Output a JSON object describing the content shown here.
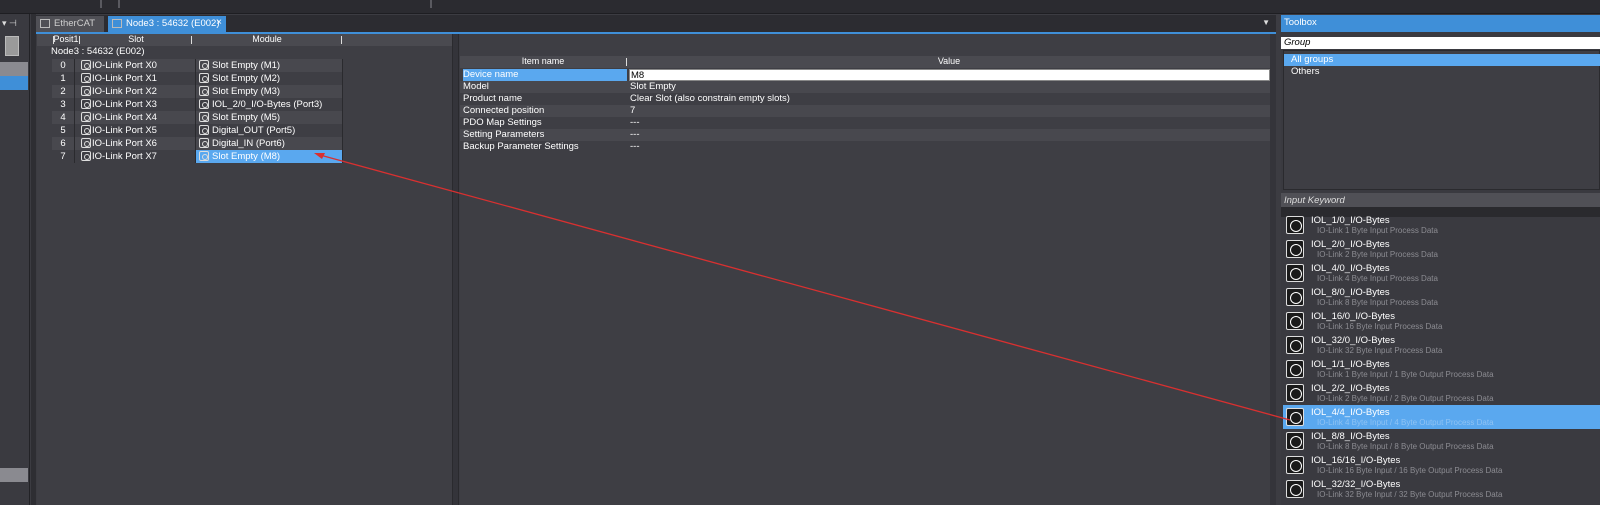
{
  "tabs": [
    {
      "label": "EtherCAT",
      "active": false
    },
    {
      "label": "Node3 : 54632 (E002)",
      "active": true,
      "close": "×"
    }
  ],
  "tab_menu_glyph": "▼",
  "left_dock_pin": "▾ ⊣",
  "module_table": {
    "headers": {
      "position": "Posit1",
      "slot": "Slot",
      "module": "Module"
    },
    "node_label": "Node3 : 54632 (E002)",
    "rows": [
      {
        "pos": "0",
        "slot": "IO-Link Port X0",
        "module": "Slot Empty (M1)",
        "selected": false
      },
      {
        "pos": "1",
        "slot": "IO-Link Port X1",
        "module": "Slot Empty (M2)",
        "selected": false
      },
      {
        "pos": "2",
        "slot": "IO-Link Port X2",
        "module": "Slot Empty (M3)",
        "selected": false
      },
      {
        "pos": "3",
        "slot": "IO-Link Port X3",
        "module": "IOL_2/0_I/O-Bytes (Port3)",
        "selected": false
      },
      {
        "pos": "4",
        "slot": "IO-Link Port X4",
        "module": "Slot Empty (M5)",
        "selected": false
      },
      {
        "pos": "5",
        "slot": "IO-Link Port X5",
        "module": "Digital_OUT (Port5)",
        "selected": false
      },
      {
        "pos": "6",
        "slot": "IO-Link Port X6",
        "module": "Digital_IN (Port6)",
        "selected": false
      },
      {
        "pos": "7",
        "slot": "IO-Link Port X7",
        "module": "Slot Empty (M8)",
        "selected": true
      }
    ]
  },
  "properties": {
    "headers": {
      "name": "Item name",
      "value": "Value"
    },
    "rows": [
      {
        "name": "Device name",
        "value": "M8",
        "selected": true
      },
      {
        "name": "Model",
        "value": "Slot Empty",
        "selected": false
      },
      {
        "name": "Product name",
        "value": "Clear Slot (also constrain empty slots)",
        "selected": false
      },
      {
        "name": "Connected position",
        "value": "7",
        "selected": false
      },
      {
        "name": "PDO Map Settings",
        "value": "---",
        "selected": false
      },
      {
        "name": "Setting Parameters",
        "value": "---",
        "selected": false
      },
      {
        "name": "Backup Parameter Settings",
        "value": "---",
        "selected": false
      }
    ]
  },
  "toolbox": {
    "title": "Toolbox",
    "group_label": "Group",
    "groups": [
      {
        "label": "All groups",
        "selected": true
      },
      {
        "label": "Others",
        "selected": false
      }
    ],
    "keyword_label": "Input Keyword",
    "items": [
      {
        "name": "IOL_1/0_I/O-Bytes",
        "desc": "IO-Link 1 Byte Input Process Data",
        "selected": false
      },
      {
        "name": "IOL_2/0_I/O-Bytes",
        "desc": "IO-Link 2 Byte Input Process Data",
        "selected": false
      },
      {
        "name": "IOL_4/0_I/O-Bytes",
        "desc": "IO-Link 4 Byte Input Process Data",
        "selected": false
      },
      {
        "name": "IOL_8/0_I/O-Bytes",
        "desc": "IO-Link 8 Byte Input Process Data",
        "selected": false
      },
      {
        "name": "IOL_16/0_I/O-Bytes",
        "desc": "IO-Link 16 Byte Input Process Data",
        "selected": false
      },
      {
        "name": "IOL_32/0_I/O-Bytes",
        "desc": "IO-Link 32 Byte Input Process Data",
        "selected": false
      },
      {
        "name": "IOL_1/1_I/O-Bytes",
        "desc": "IO-Link 1 Byte Input / 1 Byte Output Process Data",
        "selected": false
      },
      {
        "name": "IOL_2/2_I/O-Bytes",
        "desc": "IO-Link 2 Byte Input / 2 Byte Output Process Data",
        "selected": false
      },
      {
        "name": "IOL_4/4_I/O-Bytes",
        "desc": "IO-Link 4 Byte Input / 4 Byte Output Process Data",
        "selected": true
      },
      {
        "name": "IOL_8/8_I/O-Bytes",
        "desc": "IO-Link 8 Byte Input / 8 Byte Output Process Data",
        "selected": false
      },
      {
        "name": "IOL_16/16_I/O-Bytes",
        "desc": "IO-Link 16 Byte Input / 16 Byte Output Process Data",
        "selected": false
      },
      {
        "name": "IOL_32/32_I/O-Bytes",
        "desc": "IO-Link 32 Byte Input / 32 Byte Output Process Data",
        "selected": false
      }
    ]
  },
  "colors": {
    "accent": "#3f8fd8",
    "selection": "#5aa8ef",
    "background": "#3c3c42",
    "annotation_arrow": "#d93030"
  }
}
